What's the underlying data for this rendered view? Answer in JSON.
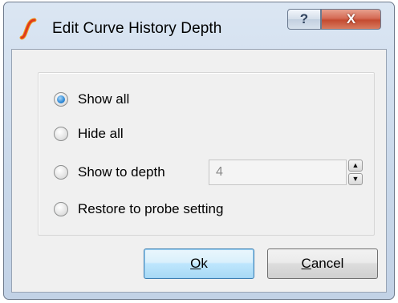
{
  "window": {
    "title": "Edit Curve History Depth",
    "help_glyph": "?",
    "close_glyph": "X"
  },
  "options": [
    {
      "label": "Show all",
      "checked": true
    },
    {
      "label": "Hide all",
      "checked": false
    },
    {
      "label": "Show to depth",
      "checked": false
    },
    {
      "label": "Restore to probe setting",
      "checked": false
    }
  ],
  "depth": {
    "value": "4",
    "enabled": false
  },
  "buttons": {
    "ok": {
      "mnemonic": "O",
      "rest": "k"
    },
    "cancel": {
      "mnemonic": "C",
      "rest": "ancel"
    }
  },
  "colors": {
    "accent": "#2f8ad8",
    "close_button": "#c44a30",
    "app_icon_stroke": "#e03a1c"
  },
  "icons": {
    "app": "app-curve-icon",
    "help": "help-icon",
    "close": "close-icon",
    "spin_up": "spin-up-icon",
    "spin_down": "spin-down-icon"
  }
}
